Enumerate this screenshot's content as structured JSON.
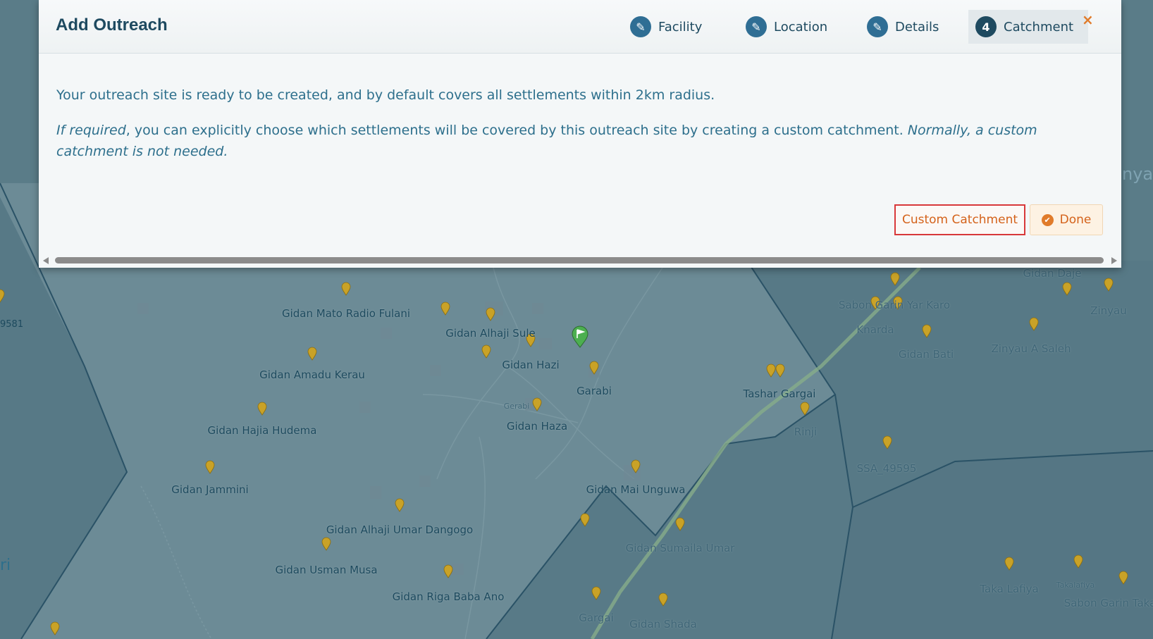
{
  "modal": {
    "title": "Add Outreach",
    "close_label": "×",
    "steps": [
      {
        "badge": "✎",
        "label": "Facility",
        "icon": "pencil-icon"
      },
      {
        "badge": "✎",
        "label": "Location",
        "icon": "pencil-icon"
      },
      {
        "badge": "✎",
        "label": "Details",
        "icon": "pencil-icon"
      },
      {
        "badge": "4",
        "label": "Catchment",
        "active": true
      }
    ],
    "para1": "Your outreach site is ready to be created, and by default covers all settlements within 2km radius.",
    "para2_em": "If required",
    "para2_text": ", you can explicitly choose which settlements will be covered by this outreach site by creating a custom catchment. ",
    "para2_em2": "Normally, a custom catchment is not needed.",
    "custom_button": "Custom Catchment",
    "done_button": "Done",
    "done_icon": "check-circle-icon"
  },
  "map": {
    "labels": [
      {
        "text": "Gidan Mato Radio Fulani",
        "style": "normal"
      },
      {
        "text": "Gidan Alhaji Sule",
        "style": "normal"
      },
      {
        "text": "Gidan Hazi",
        "style": "normal"
      },
      {
        "text": "Garabi",
        "style": "normal"
      },
      {
        "text": "Gidan Amadu Kerau",
        "style": "normal"
      },
      {
        "text": "Gidan Hajia Hudema",
        "style": "normal"
      },
      {
        "text": "Gidan Haza",
        "style": "normal"
      },
      {
        "text": "Gidan Jammini",
        "style": "normal"
      },
      {
        "text": "Gidan Mai Unguwa",
        "style": "normal"
      },
      {
        "text": "Gidan Alhaji Umar Dangogo",
        "style": "normal"
      },
      {
        "text": "Gidan Usman Musa",
        "style": "normal"
      },
      {
        "text": "Gidan Riga Baba Ano",
        "style": "normal"
      },
      {
        "text": "Tashar Gargai",
        "style": "normal"
      },
      {
        "text": "Gidan Sumaila Umar",
        "style": "faded"
      },
      {
        "text": "Gargai",
        "style": "faded"
      },
      {
        "text": "Gidan Shada",
        "style": "faded"
      },
      {
        "text": "Sabon Garin Yar Karo",
        "style": "faded"
      },
      {
        "text": "Knarda",
        "style": "faded"
      },
      {
        "text": "Gidan Bati",
        "style": "faded"
      },
      {
        "text": "Rinji",
        "style": "faded"
      },
      {
        "text": "SSA_49595",
        "style": "faded"
      },
      {
        "text": "Gidan Daje",
        "style": "faded"
      },
      {
        "text": "Zinyau",
        "style": "faded"
      },
      {
        "text": "Zinyau A Saleh",
        "style": "faded"
      },
      {
        "text": "Taka Lafiya",
        "style": "faded"
      },
      {
        "text": "Takalafiya",
        "style": "small"
      },
      {
        "text": "Sabon Garin Taka",
        "style": "faded"
      },
      {
        "text": "Gerabi",
        "style": "small"
      },
      {
        "text": "9581",
        "style": "faded"
      },
      {
        "text": "nya",
        "style": "faded"
      },
      {
        "text": "ri",
        "style": "faded"
      }
    ],
    "pin_color": "#c9a227",
    "marker_color": "#4caf50"
  }
}
